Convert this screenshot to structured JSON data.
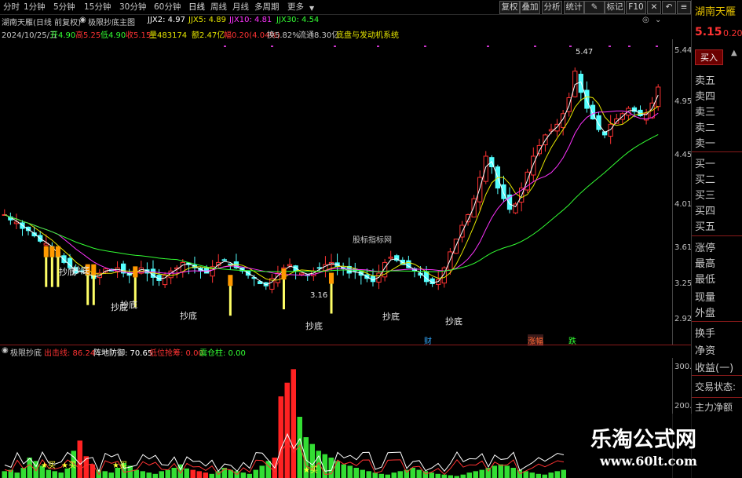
{
  "toolbar": {
    "periods": [
      "分时",
      "1分钟",
      "5分钟",
      "15分钟",
      "30分钟",
      "60分钟",
      "日线",
      "周线",
      "月线",
      "多周期",
      "更多"
    ],
    "buttons": [
      "复权",
      "叠加",
      "分析",
      "统计",
      "标记",
      "F10"
    ],
    "icons": [
      "close-icon",
      "back-icon",
      "menu-icon"
    ]
  },
  "chart_header": {
    "stock": "湖南天雁(日线 前复权)",
    "indicator": "极限抄底主图",
    "ma": [
      {
        "label": "JJX2: 4.97",
        "color": "#ffffff"
      },
      {
        "label": "JJX5: 4.89",
        "color": "#e6e600"
      },
      {
        "label": "JJX10: 4.81",
        "color": "#ff33ff"
      },
      {
        "label": "JJX30: 4.54",
        "color": "#33ff33"
      }
    ]
  },
  "quote_line": {
    "date": "2024/10/25/五",
    "open": "开4.90",
    "high": "高5.25",
    "low": "低4.90",
    "close": "收5.15",
    "volume": "量483174",
    "amount": "额2.47亿",
    "change": "幅0.20(4.04%)",
    "turnover": "换5.82%",
    "float_mv": "流通8.30亿",
    "sector": "底盘与发动机系统"
  },
  "price_axis": [
    "5.44",
    "4.95",
    "4.45",
    "4.01",
    "3.61",
    "3.25",
    "2.92"
  ],
  "annotations": {
    "high_price": "5.47",
    "low_price": "3.16",
    "signal_label": "抄底",
    "source_label": "股标指标网",
    "event_tags": [
      {
        "text": "财",
        "color": "#33aaff"
      },
      {
        "text": "涨幅",
        "color": "#ff6633"
      },
      {
        "text": "跌",
        "color": "#33ff33"
      }
    ]
  },
  "sub_chart": {
    "title": "极限抄底",
    "items": [
      {
        "label": "出击线: 86.24",
        "color": "#ff3333"
      },
      {
        "label": "阵地防御: 70.65",
        "color": "#ffffff"
      },
      {
        "label": "低位抢筹: 0.00",
        "color": "#ff3333"
      },
      {
        "label": "震仓柱: 0.00",
        "color": "#33ff33"
      }
    ],
    "axis": [
      "300.0",
      "200.0"
    ],
    "buy_label": "★买"
  },
  "right_panel": {
    "stock_name": "湖南天雁",
    "price": "5.15",
    "change_partial": "0.20",
    "buy_button": "买入",
    "order_rows": [
      "卖五",
      "卖四",
      "卖三",
      "卖二",
      "卖一",
      "买一",
      "买二",
      "买三",
      "买四",
      "买五"
    ],
    "stat_rows": [
      "涨停",
      "最高",
      "最低",
      "现量",
      "外盘",
      "换手",
      "净资",
      "收益(一)",
      "交易状态:",
      "主力净额"
    ]
  },
  "watermark": {
    "brand": "乐淘公式网",
    "url": "www.60lt.com"
  },
  "chart_data": {
    "type": "candlestick",
    "title": "湖南天雁(日线 前复权)",
    "ylim": [
      2.92,
      5.44
    ],
    "high": 5.47,
    "low": 3.16,
    "last_close": 5.15,
    "moving_averages": [
      {
        "name": "JJX2",
        "value": 4.97,
        "color": "#ffffff"
      },
      {
        "name": "JJX5",
        "value": 4.89,
        "color": "#e6e600"
      },
      {
        "name": "JJX10",
        "value": 4.81,
        "color": "#ff33ff"
      },
      {
        "name": "JJX30",
        "value": 4.54,
        "color": "#33ff33"
      }
    ],
    "close_series": [
      3.95,
      3.9,
      3.88,
      3.82,
      3.8,
      3.75,
      3.7,
      3.68,
      3.62,
      3.55,
      3.5,
      3.45,
      3.4,
      3.42,
      3.38,
      3.35,
      3.4,
      3.44,
      3.42,
      3.45,
      3.4,
      3.38,
      3.42,
      3.45,
      3.4,
      3.36,
      3.33,
      3.38,
      3.42,
      3.45,
      3.5,
      3.48,
      3.45,
      3.42,
      3.4,
      3.46,
      3.5,
      3.52,
      3.48,
      3.45,
      3.42,
      3.38,
      3.35,
      3.3,
      3.28,
      3.35,
      3.4,
      3.45,
      3.48,
      3.42,
      3.4,
      3.38,
      3.42,
      3.45,
      3.48,
      3.5,
      3.46,
      3.44,
      3.4,
      3.42,
      3.38,
      3.35,
      3.32,
      3.4,
      3.5,
      3.55,
      3.52,
      3.48,
      3.45,
      3.42,
      3.38,
      3.32,
      3.3,
      3.34,
      3.45,
      3.6,
      3.72,
      3.85,
      3.95,
      4.1,
      4.3,
      4.5,
      4.4,
      4.2,
      4.1,
      4.0,
      4.05,
      4.2,
      4.35,
      4.5,
      4.6,
      4.7,
      4.75,
      4.8,
      4.9,
      5.05,
      5.3,
      5.1,
      4.95,
      4.85,
      4.75,
      4.7,
      4.8,
      4.85,
      4.9,
      4.95,
      4.92,
      4.88,
      4.9,
      5.0,
      5.15
    ],
    "volume_series": [
      10,
      12,
      8,
      15,
      30,
      25,
      18,
      12,
      10,
      8,
      14,
      40,
      55,
      32,
      20,
      12,
      10,
      8,
      15,
      22,
      18,
      12,
      10,
      8,
      6,
      10,
      12,
      15,
      20,
      14,
      12,
      10,
      8,
      6,
      10,
      15,
      12,
      10,
      8,
      6,
      12,
      18,
      25,
      30,
      120,
      140,
      160,
      90,
      60,
      50,
      40,
      35,
      30,
      25,
      20,
      18,
      15,
      12,
      10,
      8,
      6,
      5,
      8,
      10,
      12,
      15,
      12,
      10,
      8,
      6,
      5,
      4,
      3,
      5,
      8,
      10,
      12,
      15,
      18,
      20,
      18,
      15,
      12,
      10,
      8,
      6,
      5,
      8,
      10,
      12
    ]
  }
}
